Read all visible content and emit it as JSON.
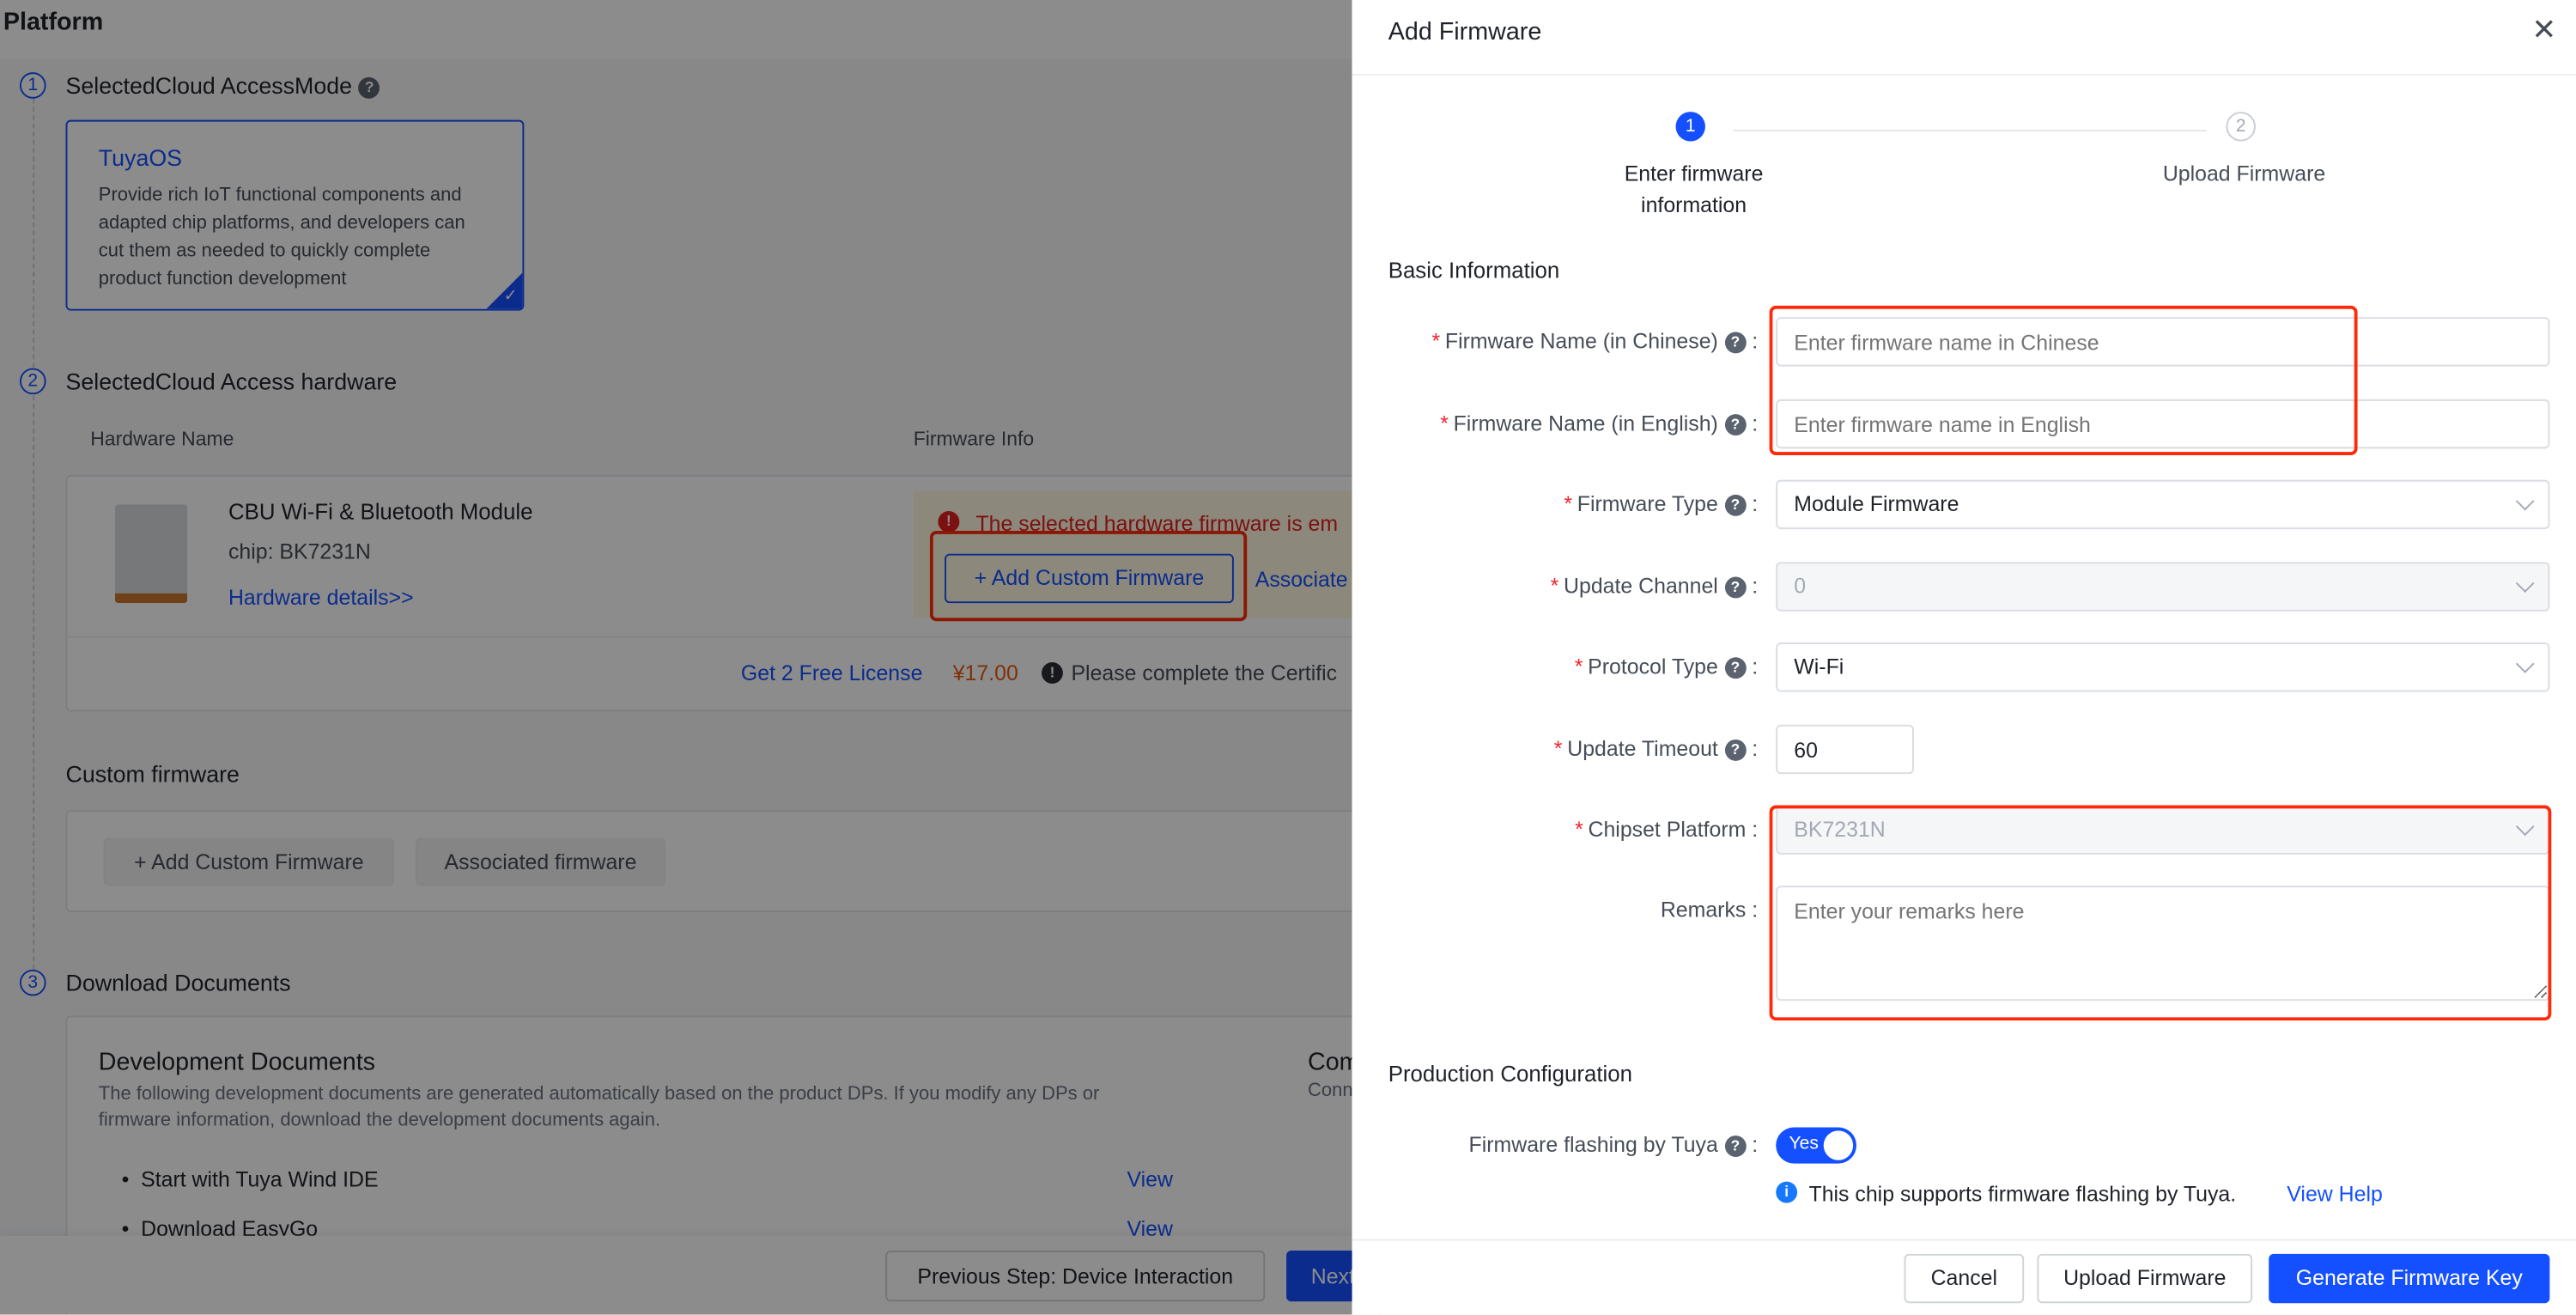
{
  "page": {
    "title": "Platform",
    "steps": [
      {
        "num": "1",
        "title": "SelectedCloud AccessMode"
      },
      {
        "num": "2",
        "title": "SelectedCloud Access hardware"
      },
      {
        "num": "3",
        "title": "Download Documents"
      }
    ],
    "mode_card": {
      "title": "TuyaOS",
      "desc": [
        "Provide rich IoT functional components and",
        "adapted chip platforms, and developers can",
        "cut them as needed to quickly complete",
        "product function development"
      ]
    },
    "hardware_table": {
      "headers": [
        "Hardware Name",
        "Firmware Info"
      ],
      "row": {
        "name": "CBU Wi-Fi & Bluetooth Module",
        "chip": "chip: BK7231N",
        "details_link": "Hardware details>>",
        "warning": "The selected hardware firmware is em",
        "add_button": "+ Add Custom Firmware",
        "associate_link": "Associate",
        "license_link": "Get 2 Free License",
        "price": "¥17.00",
        "cert_note": "Please complete the Certific"
      }
    },
    "custom_firmware": {
      "title": "Custom firmware",
      "add_button": "+ Add Custom Firmware",
      "associated_button": "Associated firmware"
    },
    "documents": {
      "dev_title": "Development Documents",
      "dev_desc": [
        "The following development documents are generated automatically based on the product DPs. If you modify any DPs or",
        "firmware information, download the development documents again."
      ],
      "items": [
        {
          "label": "Start with Tuya Wind IDE",
          "action": "View"
        },
        {
          "label": "Download EasyGo",
          "action": "View"
        }
      ],
      "other_title": "Com",
      "other_desc": "Conn"
    },
    "footer": {
      "prev_button": "Previous Step: Device Interaction",
      "next_button": "Next"
    }
  },
  "drawer": {
    "title": "Add Firmware",
    "close_icon": "close-icon",
    "steps": [
      {
        "num": "1",
        "label_lines": [
          "Enter firmware",
          "information"
        ],
        "status": "active"
      },
      {
        "num": "2",
        "label_lines": [
          "Upload Firmware"
        ],
        "status": "pending"
      }
    ],
    "basic_title": "Basic Information",
    "fields": {
      "name_cn": {
        "label": "Firmware Name (in Chinese)",
        "placeholder": "Enter firmware name in Chinese",
        "required": true
      },
      "name_en": {
        "label": "Firmware Name (in English)",
        "placeholder": "Enter firmware name in English",
        "required": true
      },
      "type": {
        "label": "Firmware Type",
        "value": "Module Firmware",
        "required": true
      },
      "channel": {
        "label": "Update Channel",
        "value": "0",
        "required": true,
        "disabled": true
      },
      "protocol": {
        "label": "Protocol Type",
        "value": "Wi-Fi",
        "required": true
      },
      "timeout": {
        "label": "Update Timeout",
        "value": "60",
        "required": true
      },
      "chipset": {
        "label": "Chipset Platform",
        "value": "BK7231N",
        "required": true,
        "disabled": true
      },
      "remarks": {
        "label": "Remarks",
        "placeholder": "Enter your remarks here"
      }
    },
    "production_title": "Production Configuration",
    "flashing": {
      "label": "Firmware flashing by Tuya",
      "toggle_text": "Yes",
      "enabled": true,
      "info": "This chip supports firmware flashing by Tuya.",
      "help_link": "View Help"
    },
    "buttons": {
      "cancel": "Cancel",
      "upload": "Upload Firmware",
      "generate": "Generate Firmware Key"
    }
  },
  "colors": {
    "accent": "#1450ff",
    "required": "#f5222d",
    "highlight": "#ff2a0a",
    "price": "#e8590c"
  }
}
